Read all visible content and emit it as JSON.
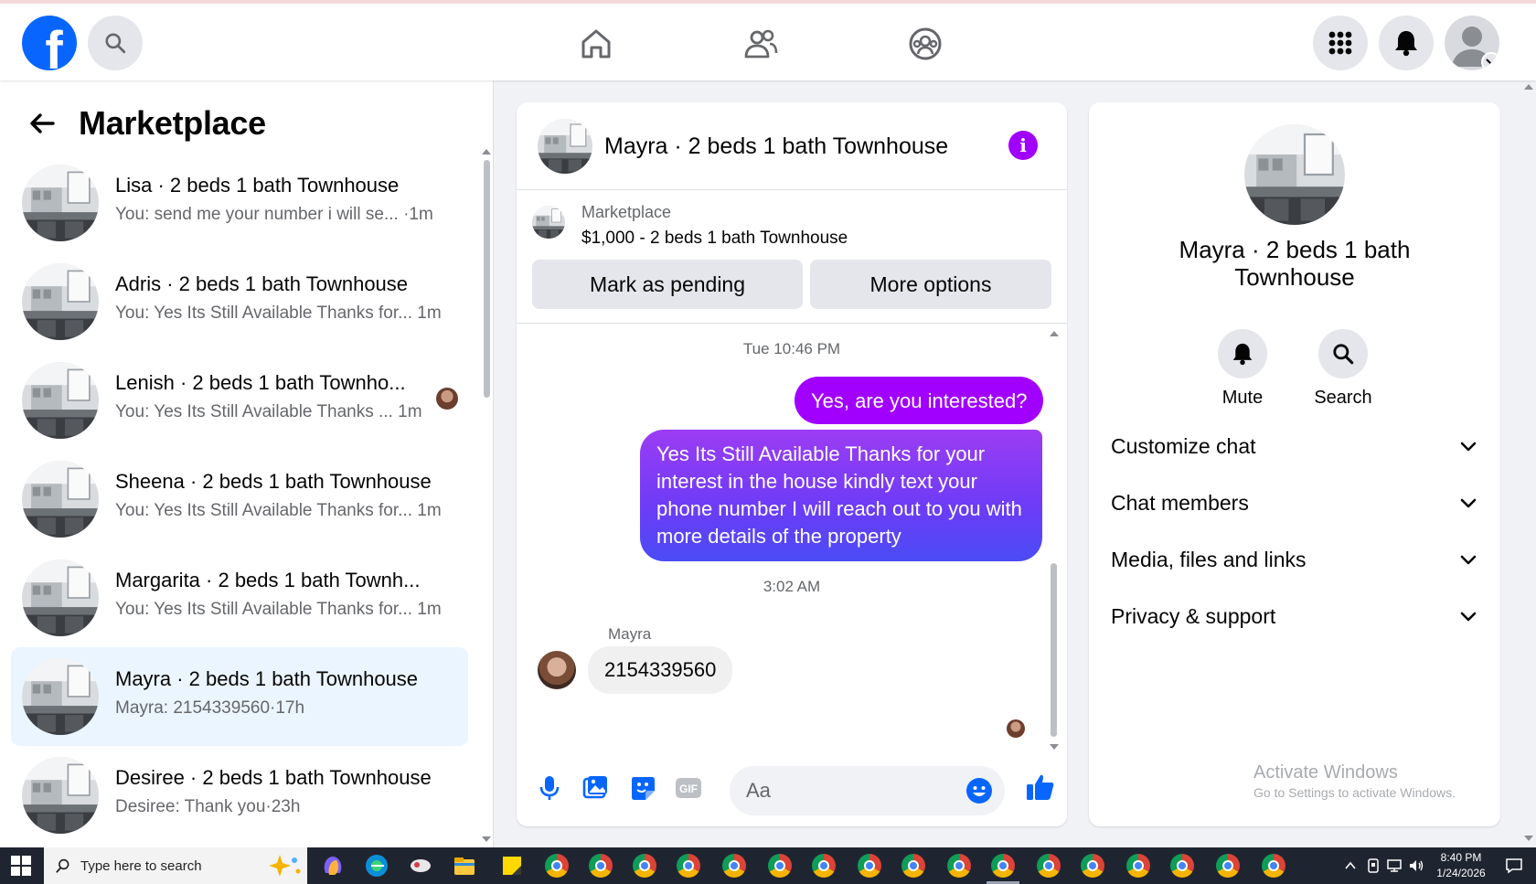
{
  "left": {
    "title": "Marketplace",
    "conversations": [
      {
        "name": "Lisa · 2 beds 1 bath Townhouse",
        "snippet": "You: send me your number i will se...",
        "time": "·1m"
      },
      {
        "name": "Adris · 2 beds 1 bath Townhouse",
        "snippet": "You: Yes Its Still Available Thanks for...",
        "time": "1m"
      },
      {
        "name": "Lenish · 2 beds 1 bath Townho...",
        "snippet": "You: Yes Its Still Available Thanks ...",
        "time": "1m"
      },
      {
        "name": "Sheena · 2 beds 1 bath Townhouse",
        "snippet": "You: Yes Its Still Available Thanks for...",
        "time": "1m"
      },
      {
        "name": "Margarita · 2 beds 1 bath Townh...",
        "snippet": "You: Yes Its Still Available Thanks for...",
        "time": "1m"
      },
      {
        "name": "Mayra · 2 beds 1 bath Townhouse",
        "snippet": "Mayra: 2154339560",
        "time": "·17h"
      },
      {
        "name": "Desiree · 2 beds 1 bath Townhouse",
        "snippet": "Desiree: Thank you",
        "time": "·23h"
      }
    ]
  },
  "chat": {
    "header_name": "Mayra · 2 beds 1 bath Townhouse",
    "listing": {
      "source": "Marketplace",
      "title": "$1,000 - 2 beds 1 bath Townhouse",
      "mark_pending_label": "Mark as pending",
      "more_options_label": "More options"
    },
    "timestamp1": "Tue 10:46 PM",
    "out_msg1": "Yes, are you interested?",
    "out_msg2": "Yes Its Still Available Thanks for your interest in the house kindly text your phone number I will reach out to you with more details of the property",
    "timestamp2": "3:02 AM",
    "sender": "Mayra",
    "in_msg": "2154339560",
    "composer_placeholder": "Aa"
  },
  "right": {
    "name": "Mayra · 2 beds 1 bath Townhouse",
    "mute_label": "Mute",
    "search_label": "Search",
    "sections": [
      "Customize chat",
      "Chat members",
      "Media, files and links",
      "Privacy & support"
    ],
    "activate_title": "Activate Windows",
    "activate_sub": "Go to Settings to activate Windows."
  },
  "taskbar": {
    "search_placeholder": "Type here to search",
    "time": "8:40 PM",
    "date": "1/24/2026"
  },
  "colors": {
    "brand_blue": "#0866ff",
    "messenger_purple": "#a100ff",
    "active_row": "#ebf5ff"
  }
}
